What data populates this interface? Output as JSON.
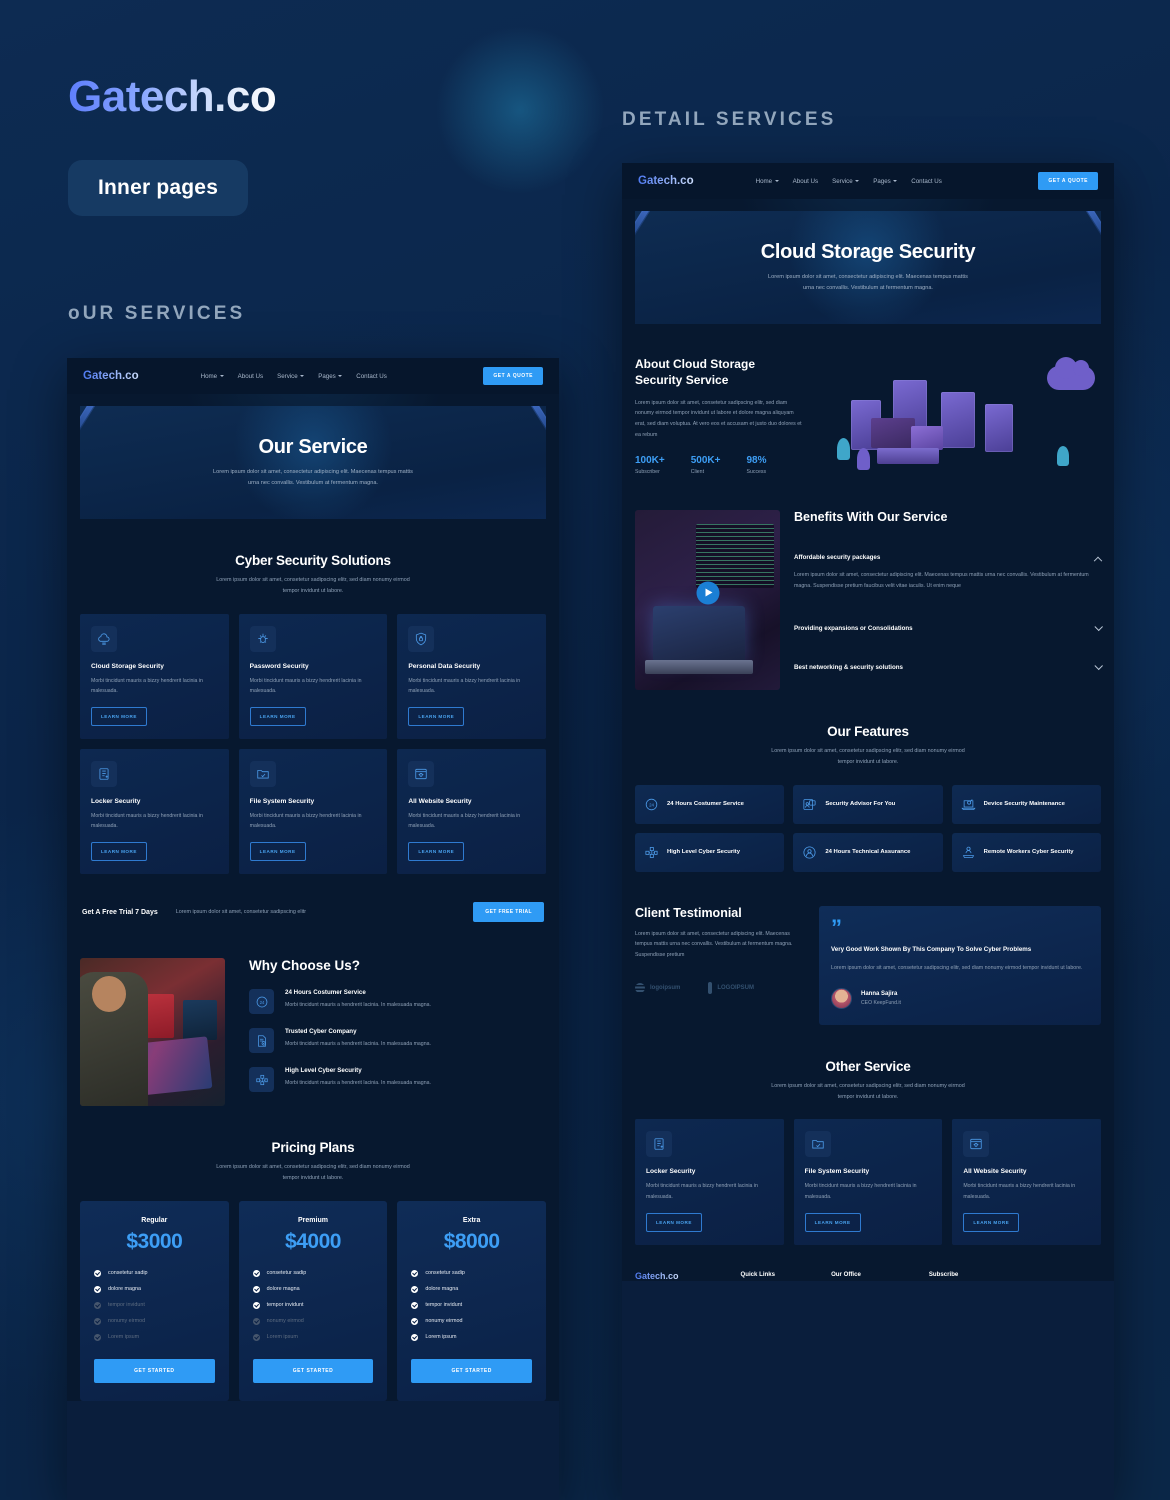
{
  "presentation": {
    "brand": "Gatech.co",
    "pill_label": "Inner pages",
    "label_our_services": "oUR SERVICES",
    "label_detail_services": "DETAIL SERVICES",
    "accent": "#2f9bf5",
    "background": "#0c2a50",
    "price_color": "#3d9ef5"
  },
  "nav": {
    "logo": "Gatech.co",
    "links": [
      {
        "label": "Home",
        "caret": true
      },
      {
        "label": "About Us",
        "caret": false
      },
      {
        "label": "Service",
        "caret": true
      },
      {
        "label": "Pages",
        "caret": true
      },
      {
        "label": "Contact Us",
        "caret": false
      }
    ],
    "cta": "GET A QUOTE"
  },
  "page_services": {
    "hero": {
      "title": "Our Service",
      "subtitle": "Lorem ipsum dolor sit amet, consectetur adipiscing elit. Maecenas tempus mattis urna nec convallis. Vestibulum at fermentum magna."
    },
    "solutions": {
      "title": "Cyber Security Solutions",
      "subtitle": "Lorem ipsum dolor sit amet, consetetur sadipscing elitr, sed diam nonumy eirmod tempor invidunt ut labore.",
      "cards": [
        {
          "icon": "cloud-security-icon",
          "title": "Cloud Storage Security",
          "desc": "Morbi tincidunt mauris a bizzy hendrerit lacinia in malesuada.",
          "cta": "LEARN MORE"
        },
        {
          "icon": "password-bug-icon",
          "title": "Password Security",
          "desc": "Morbi tincidunt mauris a bizzy hendrerit lacinia in malesuada.",
          "cta": "LEARN MORE"
        },
        {
          "icon": "shield-lock-icon",
          "title": "Personal Data Security",
          "desc": "Morbi tincidunt mauris a bizzy hendrerit lacinia in malesuada.",
          "cta": "LEARN MORE"
        },
        {
          "icon": "locker-icon",
          "title": "Locker Security",
          "desc": "Morbi tincidunt mauris a bizzy hendrerit lacinia in malesuada.",
          "cta": "LEARN MORE"
        },
        {
          "icon": "folder-check-icon",
          "title": "File System Security",
          "desc": "Morbi tincidunt mauris a bizzy hendrerit lacinia in malesuada.",
          "cta": "LEARN MORE"
        },
        {
          "icon": "website-bug-icon",
          "title": "All Website Security",
          "desc": "Morbi tincidunt mauris a bizzy hendrerit lacinia in malesuada.",
          "cta": "LEARN MORE"
        }
      ]
    },
    "trial": {
      "title": "Get A Free Trial 7 Days",
      "text": "Lorem ipsum dolor sit amet, consetetur sadipscing elitr",
      "cta": "GET FREE TRIAL"
    },
    "why": {
      "title": "Why Choose Us?",
      "image_alt": "developer-at-desk-photo",
      "items": [
        {
          "icon": "clock-24-icon",
          "title": "24 Hours Costumer Service",
          "desc": "Morbi tincidunt mauris a hendrerit lacinia. In malesuada magna."
        },
        {
          "icon": "document-check-icon",
          "title": "Trusted Cyber Company",
          "desc": "Morbi tincidunt mauris a hendrerit lacinia. In malesuada magna."
        },
        {
          "icon": "network-nodes-icon",
          "title": "High Level Cyber Security",
          "desc": "Morbi tincidunt mauris a hendrerit lacinia. In malesuada magna."
        }
      ]
    },
    "pricing": {
      "title": "Pricing Plans",
      "subtitle": "Lorem ipsum dolor sit amet, consetetur sadipscing elitr, sed diam nonumy eirmod tempor invidunt ut labore.",
      "plans": [
        {
          "name": "Regular",
          "price": "$3000",
          "cta": "GET STARTED",
          "features": [
            {
              "label": "consetetur sadip",
              "active": true
            },
            {
              "label": "dolore magna",
              "active": true
            },
            {
              "label": "tempor invidunt",
              "active": false
            },
            {
              "label": "nonumy eirmod",
              "active": false
            },
            {
              "label": "Lorem ipsum",
              "active": false
            }
          ]
        },
        {
          "name": "Premium",
          "price": "$4000",
          "cta": "GET STARTED",
          "features": [
            {
              "label": "consetetur sadip",
              "active": true
            },
            {
              "label": "dolore magna",
              "active": true
            },
            {
              "label": "tempor invidunt",
              "active": true
            },
            {
              "label": "nonumy eirmod",
              "active": false
            },
            {
              "label": "Lorem ipsum",
              "active": false
            }
          ]
        },
        {
          "name": "Extra",
          "price": "$8000",
          "cta": "GET STARTED",
          "features": [
            {
              "label": "consetetur sadip",
              "active": true
            },
            {
              "label": "dolore magna",
              "active": true
            },
            {
              "label": "tempor invidunt",
              "active": true
            },
            {
              "label": "nonumy eirmod",
              "active": true
            },
            {
              "label": "Lorem ipsum",
              "active": true
            }
          ]
        }
      ]
    }
  },
  "page_detail": {
    "hero": {
      "title": "Cloud Storage Security",
      "subtitle": "Lorem ipsum dolor sit amet, consectetur adipiscing elit. Maecenas tempus mattis urna nec convallis. Vestibulum at fermentum magna."
    },
    "about": {
      "title": "About Cloud Storage Security Service",
      "text": "Lorem ipsum dolor sit amet, consetetur sadipscing elitr, sed diam nonumy eirmod tempor invidunt ut labore et dolore magna aliquyam erat, sed diam voluptua. At vero eos et accusam et justo duo dolores et ea rebum",
      "illustration_alt": "isometric-server-cloud-illustration",
      "stats": [
        {
          "value": "100K+",
          "label": "Subscriber"
        },
        {
          "value": "500K+",
          "label": "Client"
        },
        {
          "value": "98%",
          "label": "Success"
        }
      ]
    },
    "benefits": {
      "title": "Benefits With Our Service",
      "video_alt": "laptop-code-video-thumbnail",
      "items": [
        {
          "title": "Affordable security packages",
          "open": true,
          "body": "Lorem ipsum dolor sit amet, consectetur adipiscing elit. Maecenas tempus mattis urna nec convallis. Vestibulum at fermentum magna. Suspendisse pretium faucibus velit vitae iaculis. Ut enim neque"
        },
        {
          "title": "Providing expansions or Consolidations",
          "open": false,
          "body": ""
        },
        {
          "title": "Best networking & security solutions",
          "open": false,
          "body": ""
        }
      ]
    },
    "features": {
      "title": "Our Features",
      "subtitle": "Lorem ipsum dolor sit amet, consetetur sadipscing elitr, sed diam nonumy eirmod tempor invidunt ut labore.",
      "items": [
        {
          "icon": "clock-24-icon",
          "label": "24 Hours Costumer Service"
        },
        {
          "icon": "security-advisor-icon",
          "label": "Security Advisor For You"
        },
        {
          "icon": "device-maintenance-icon",
          "label": "Device Security Maintenance"
        },
        {
          "icon": "network-nodes-icon",
          "label": "High Level Cyber Security"
        },
        {
          "icon": "technical-assurance-icon",
          "label": "24 Hours Technical Assurance"
        },
        {
          "icon": "remote-worker-icon",
          "label": "Remote Workers Cyber Security"
        }
      ]
    },
    "testimonial": {
      "title": "Client Testimonial",
      "text": "Lorem ipsum dolor sit amet, consectetur adipiscing elit. Maecenas tempus mattis urna nec convallis. Vestibulum at fermentum magna. Suspendisse pretium",
      "logos": [
        "logoipsum",
        "LOGOIPSUM"
      ],
      "card": {
        "quote_mark": "”",
        "headline": "Very Good Work Shown By This Company To Solve Cyber Problems",
        "body": "Lorem ipsum dolor sit amet, consetetur sadipscing elitr, sed diam nonumy eirmod tempor invidunt ut labore.",
        "author_name": "Hanna Sajira",
        "author_role": "CEO KeepFund.it"
      }
    },
    "other": {
      "title": "Other Service",
      "subtitle": "Lorem ipsum dolor sit amet, consetetur sadipscing elitr, sed diam nonumy eirmod tempor invidunt ut labore.",
      "cards": [
        {
          "icon": "locker-icon",
          "title": "Locker Security",
          "desc": "Morbi tincidunt mauris a bizzy hendrerit lacinia in malesuada.",
          "cta": "LEARN MORE"
        },
        {
          "icon": "folder-check-icon",
          "title": "File System Security",
          "desc": "Morbi tincidunt mauris a bizzy hendrerit lacinia in malesuada.",
          "cta": "LEARN MORE"
        },
        {
          "icon": "website-bug-icon",
          "title": "All Website Security",
          "desc": "Morbi tincidunt mauris a bizzy hendrerit lacinia in malesuada.",
          "cta": "LEARN MORE"
        }
      ]
    },
    "footer": {
      "logo": "Gatech.co",
      "col1": "Quick Links",
      "col2": "Our Office",
      "col3": "Subscribe"
    }
  }
}
